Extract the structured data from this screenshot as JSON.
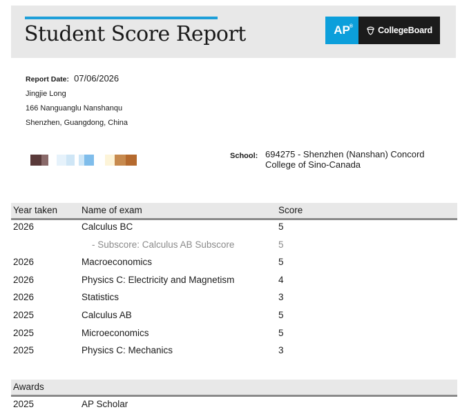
{
  "header": {
    "title": "Student Score Report",
    "logo": {
      "ap_text": "AP",
      "ap_mark": "®",
      "collegeboard_text": "CollegeBoard",
      "colors": {
        "ap_blue": "#0c9fdb",
        "cb_black": "#1b1b1b",
        "accent": "#1e9fd9"
      }
    }
  },
  "student": {
    "report_date_label": "Report Date:",
    "report_date": "07/06/2026",
    "name": "Jingjie Long",
    "address_line1": "166 Nanguanglu Nanshanqu",
    "address_line2": "Shenzhen, Guangdong, China"
  },
  "redacted_colors": [
    "#5a3a3a",
    "#8a6a6a",
    "#ffffff",
    "#e6f2fb",
    "#cfe6f6",
    "#ffffff",
    "#cde6f7",
    "#7fbdeb",
    "#ffffff",
    "#fdf4d8",
    "#c78a4e",
    "#b56a2e"
  ],
  "school": {
    "label": "School:",
    "value": "694275 - Shenzhen (Nanshan) Concord College of Sino-Canada"
  },
  "table": {
    "columns": [
      "Year taken",
      "Name of exam",
      "Score"
    ],
    "rows": [
      {
        "year": "2026",
        "exam": "Calculus BC",
        "score": "5",
        "sub": false
      },
      {
        "year": "",
        "exam": "- Subscore: Calculus AB Subscore",
        "score": "5",
        "sub": true
      },
      {
        "year": "2026",
        "exam": "Macroeconomics",
        "score": "5",
        "sub": false
      },
      {
        "year": "2026",
        "exam": "Physics C: Electricity and Magnetism",
        "score": "4",
        "sub": false
      },
      {
        "year": "2026",
        "exam": "Statistics",
        "score": "3",
        "sub": false
      },
      {
        "year": "2025",
        "exam": "Calculus AB",
        "score": "5",
        "sub": false
      },
      {
        "year": "2025",
        "exam": "Microeconomics",
        "score": "5",
        "sub": false
      },
      {
        "year": "2025",
        "exam": "Physics C: Mechanics",
        "score": "3",
        "sub": false
      }
    ]
  },
  "awards": {
    "heading": "Awards",
    "rows": [
      {
        "year": "2025",
        "name": "AP Scholar"
      }
    ]
  }
}
